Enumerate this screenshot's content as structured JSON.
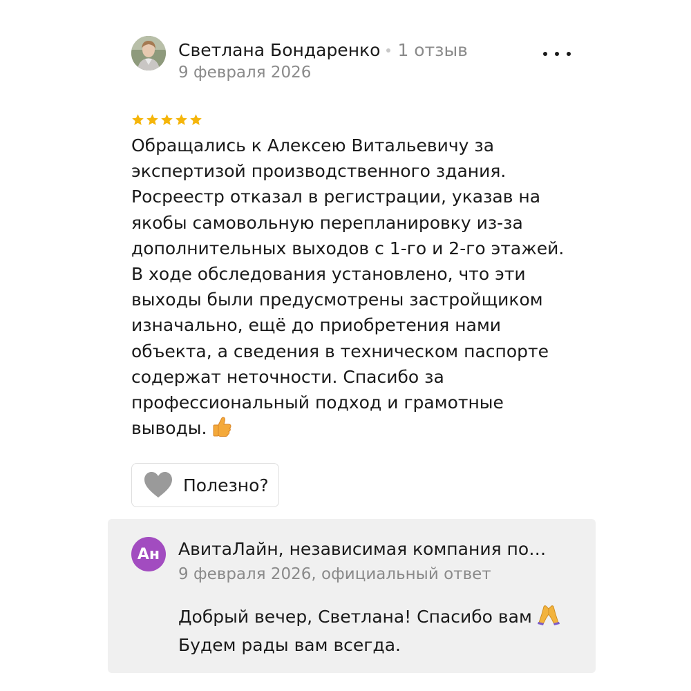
{
  "review": {
    "author_name": "Светлана Бондаренко",
    "review_count": "1 отзыв",
    "date": "9 февраля 2026",
    "rating": 5,
    "rating_max": 5,
    "star_color": "#f5b50a",
    "text_lines": [
      "Обращались к Алексею Витальевичу за",
      "экспертизой производственного здания.",
      "Росреестр отказал в регистрации, указав на",
      "якобы самовольную перепланировку из-за",
      "дополнительных выходов с 1-го и 2-го этажей.",
      "В ходе обследования установлено, что эти",
      "выходы были предусмотрены застройщиком",
      "изначально, ещё до приобретения нами",
      "объекта, а сведения в техническом паспорте",
      "содержат неточности. Спасибо за",
      "профессиональный подход и грамотные",
      "выводы."
    ],
    "text_end_emoji": "thumbs-up-icon",
    "helpful_label": "Полезно?",
    "more_icon": "more-dots-icon"
  },
  "reply": {
    "avatar_initials": "Ан",
    "avatar_color": "#a24cc0",
    "company_name": "АвитаЛайн, независимая компания по…",
    "meta": "9 февраля 2026, официальный ответ",
    "text_lines": [
      "Добрый вечер, Светлана! Спасибо вам",
      "Будем рады вам всегда."
    ],
    "text_emoji": "folded-hands-icon"
  }
}
